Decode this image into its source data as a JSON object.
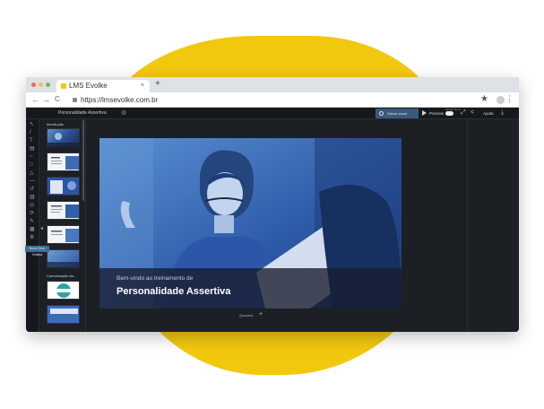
{
  "browser": {
    "tab_title": "LMS Evolke",
    "tab_close": "×",
    "new_tab": "+",
    "url": "https://lmsevolke.com.br",
    "back": "←",
    "forward": "→",
    "reload": "C",
    "star": "★",
    "menu": "⋮",
    "colors": {
      "close": "#ed6a5e",
      "min": "#f5bf4f",
      "max": "#61c554"
    }
  },
  "app": {
    "doc_title": "Personalidade Assertiva",
    "settings_icon": "⚙",
    "save_sequence": "Salvar como Sequência",
    "preview": "Preview",
    "toggle_label": "Mudar Tema",
    "expand_icon": "⤢",
    "share_icon": "<",
    "help_label": "Ajuda",
    "download_icon": "⤓"
  },
  "tools": [
    "↖",
    "/",
    "T",
    "▤",
    "○",
    "□",
    "△",
    "—",
    "↺",
    "▥",
    "◎",
    "⟳",
    "✎",
    "▦",
    "⚙"
  ],
  "thumbs": {
    "intro_label": "Introdução",
    "section_label": "Comunicação As...",
    "collapse_icon": "◂"
  },
  "new_scene": "Nova Cena Gráfica",
  "slide": {
    "subtitle": "Bem-vindo ao treinamento de",
    "title": "Personalidade Assertiva"
  },
  "frames": {
    "label": "Quadros",
    "add": "+"
  },
  "accent_colors": {
    "brand_yellow": "#f2c80f",
    "slide_blue": "#2b56a6"
  }
}
